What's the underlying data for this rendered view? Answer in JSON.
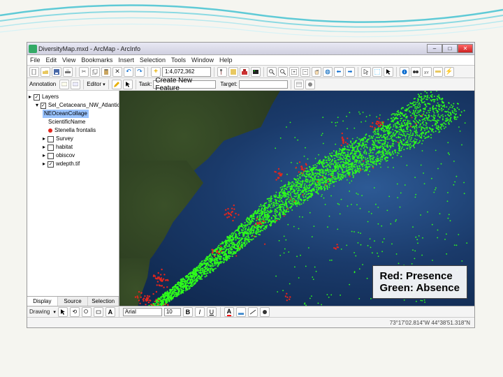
{
  "window": {
    "title": "DiversityMap.mxd - ArcMap - ArcInfo",
    "minimize": "–",
    "maximize": "□",
    "close": "✕"
  },
  "menu": {
    "file": "File",
    "edit": "Edit",
    "view": "View",
    "bookmarks": "Bookmarks",
    "insert": "Insert",
    "selection": "Selection",
    "tools": "Tools",
    "window": "Window",
    "help": "Help"
  },
  "toolbar": {
    "scale": "1:4,072,362"
  },
  "annotation_bar": {
    "label": "Annotation",
    "editor_label": "Editor",
    "task_label": "Task:",
    "task_value": "Create New Feature",
    "target_label": "Target:"
  },
  "toc": {
    "root": "Layers",
    "group": "Sel_Cetaceans_NW_Atlantic",
    "selected_item": "NEOceanCollage",
    "sym_label": "ScientificName",
    "sym_item1": "Stenella frontalis",
    "lyr_survey": "Survey",
    "lyr_habitat": "habitat",
    "lyr_obiscov": "obiscov",
    "lyr_wdepth": "wdepth.tif",
    "tabs": {
      "display": "Display",
      "source": "Source",
      "selection": "Selection"
    }
  },
  "overlay": {
    "line1": "Red: Presence",
    "line2": "Green: Absence"
  },
  "drawing_bar": {
    "label": "Drawing",
    "font": "Arial",
    "size": "10"
  },
  "colors": {
    "presence": "#e2261d",
    "absence": "#2eff1a"
  },
  "statusbar": {
    "coords": "73°17'02.814\"W  44°38'51.318\"N"
  }
}
